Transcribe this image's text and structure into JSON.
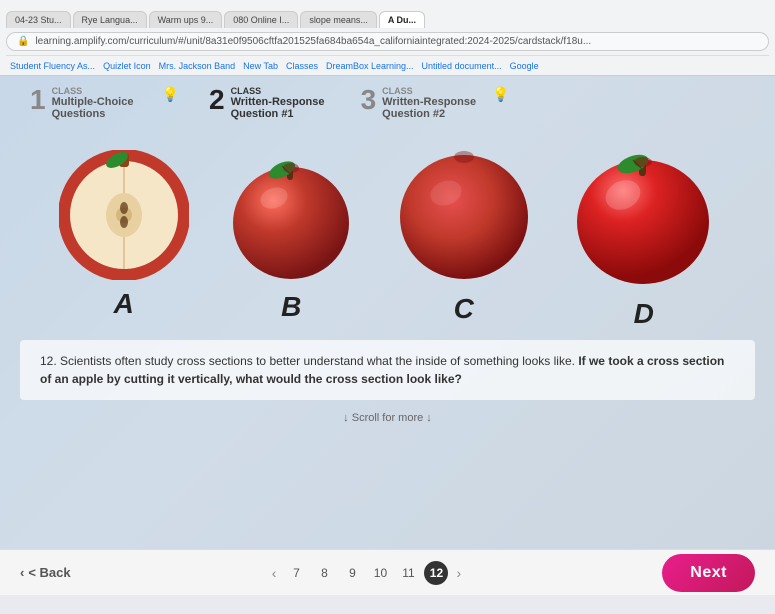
{
  "browser": {
    "tabs": [
      {
        "label": "04-23 Stu...",
        "active": false
      },
      {
        "label": "Rye Langua...",
        "active": false
      },
      {
        "label": "Warm ups 9...",
        "active": false
      },
      {
        "label": "080 Online l...",
        "active": false
      },
      {
        "label": "slope means...",
        "active": false
      },
      {
        "label": "A Dust...",
        "active": true
      }
    ],
    "address": "learning.amplify.com/curriculum/#/unit/8a31e0f9506cftfa201525fa684ba654a_californiaintegrated:2024-2025/cardstack/f18u...",
    "bookmarks": [
      "Student Fluency As...",
      "Quizlet Icon",
      "Mrs. Jackson Band",
      "New Tab",
      "Classes",
      "DreamBox Learning...",
      "Untitled document...",
      "Google"
    ]
  },
  "steps": [
    {
      "number": "1",
      "class_label": "CLASS",
      "title": "Multiple-Choice Questions",
      "active": false
    },
    {
      "number": "2",
      "class_label": "CLASS",
      "title": "Written-Response Question #1",
      "active": false
    },
    {
      "number": "3",
      "class_label": "CLASS",
      "title": "Written-Response Question #2",
      "active": true
    }
  ],
  "apples": [
    {
      "label": "A",
      "type": "cross-section"
    },
    {
      "label": "B",
      "type": "whole"
    },
    {
      "label": "C",
      "type": "whole-dark"
    },
    {
      "label": "D",
      "type": "whole-bright"
    }
  ],
  "question": {
    "number": "12",
    "text": "Scientists often study cross sections to better understand what the inside of something looks like.",
    "bold_text": "If we took a cross section of an apple by cutting it vertically, what would the cross section look like?"
  },
  "scroll_hint": "↓ Scroll for more ↓",
  "navigation": {
    "back_label": "< Back",
    "pages": [
      "7",
      "8",
      "9",
      "10",
      "11",
      "12"
    ],
    "active_page": "12",
    "next_label": "Next"
  }
}
